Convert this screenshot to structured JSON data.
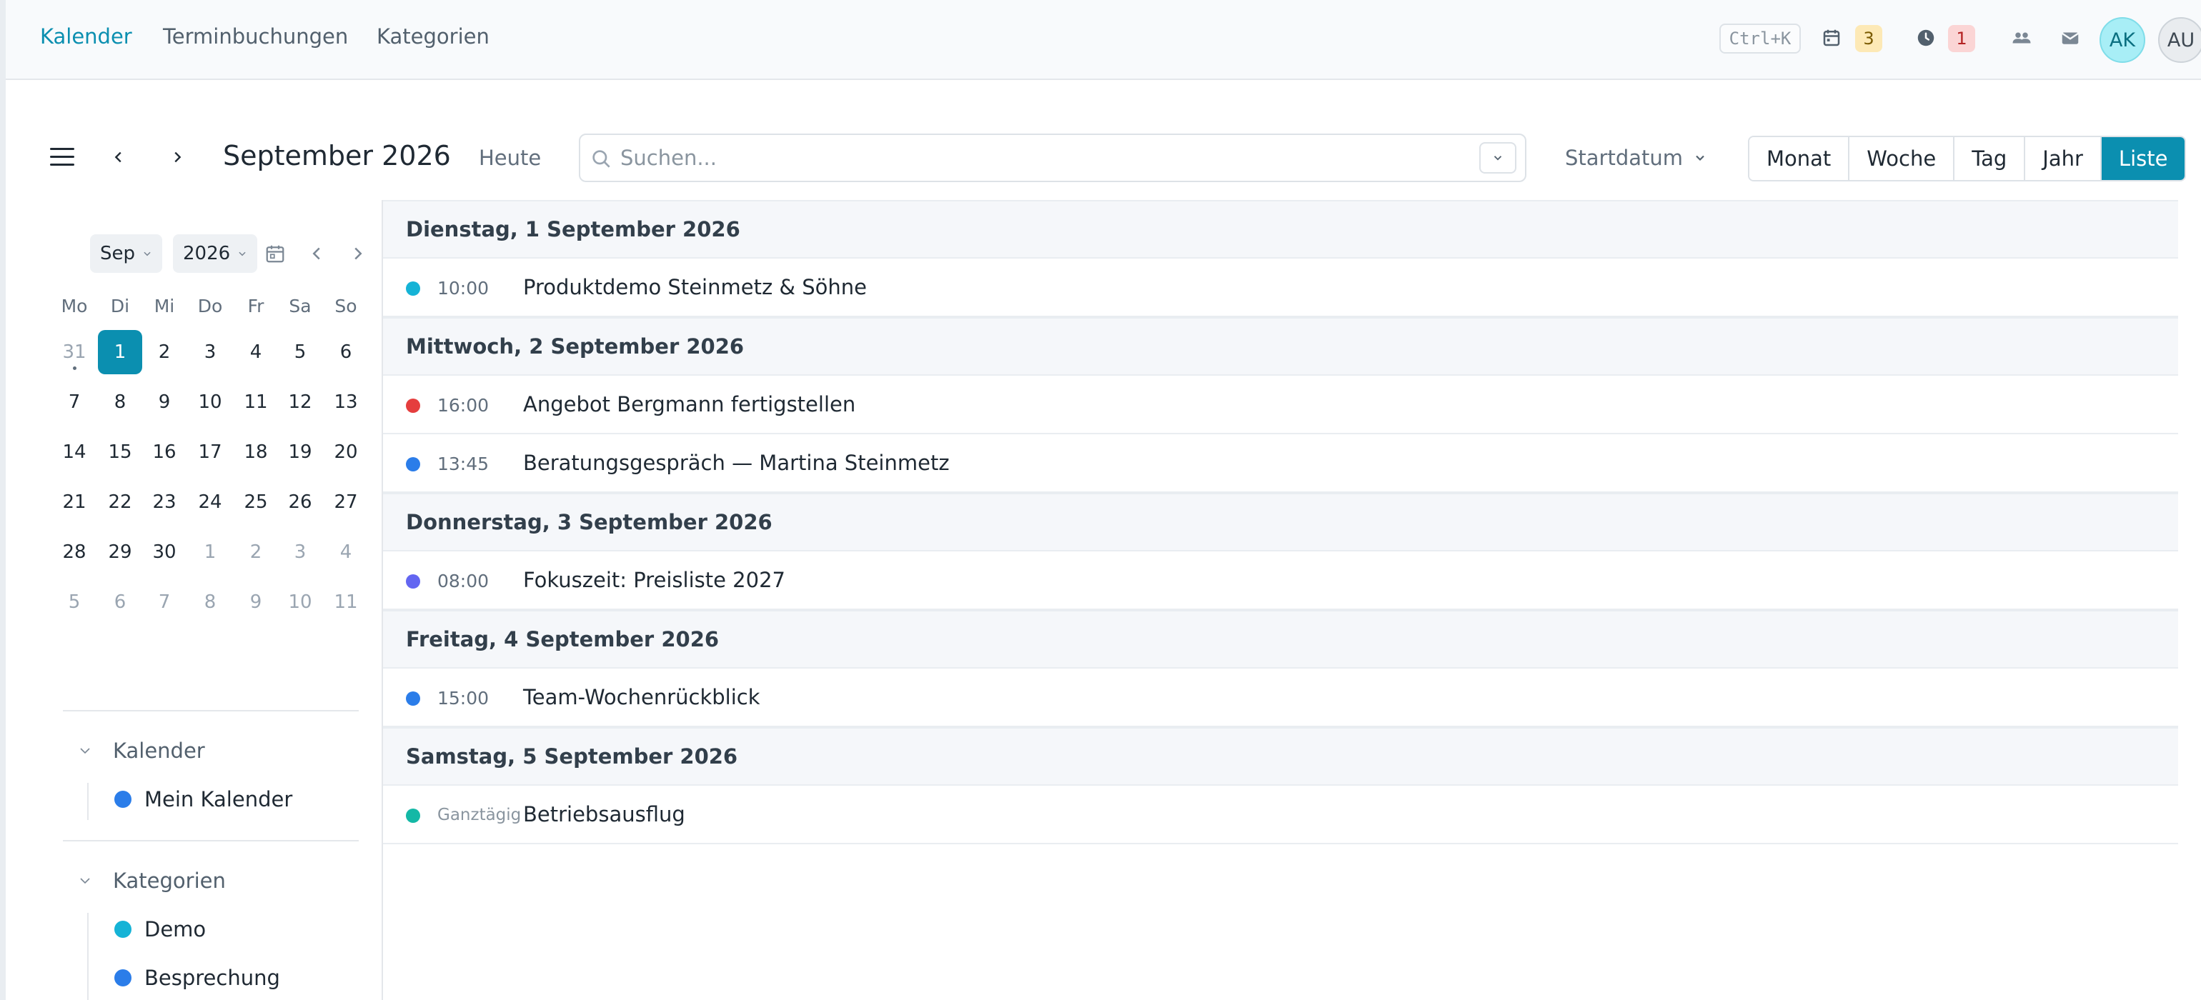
{
  "nav": {
    "links": [
      "Kalender",
      "Terminbuchungen",
      "Kategorien"
    ],
    "shortcut": "Ctrl+K",
    "calendar_badge": "3",
    "clock_badge": "1",
    "avatar_primary": "AK",
    "avatar_secondary": "AU",
    "accent_color": "#0b8fb0"
  },
  "toolbar": {
    "title": "September 2026",
    "today_label": "Heute",
    "search_placeholder": "Suchen...",
    "sort_label": "Startdatum",
    "views": [
      "Monat",
      "Woche",
      "Tag",
      "Jahr",
      "Liste"
    ],
    "active_view": "Liste"
  },
  "mini_calendar": {
    "month_select": "Sep",
    "year_select": "2026",
    "weekdays": [
      "Mo",
      "Di",
      "Mi",
      "Do",
      "Fr",
      "Sa",
      "So"
    ],
    "weeks": [
      [
        "31",
        "1",
        "2",
        "3",
        "4",
        "5",
        "6"
      ],
      [
        "7",
        "8",
        "9",
        "10",
        "11",
        "12",
        "13"
      ],
      [
        "14",
        "15",
        "16",
        "17",
        "18",
        "19",
        "20"
      ],
      [
        "21",
        "22",
        "23",
        "24",
        "25",
        "26",
        "27"
      ],
      [
        "28",
        "29",
        "30",
        "1",
        "2",
        "3",
        "4"
      ],
      [
        "5",
        "6",
        "7",
        "8",
        "9",
        "10",
        "11"
      ]
    ],
    "selected_day": "1"
  },
  "sidebar": {
    "calendars_heading": "Kalender",
    "calendars": [
      {
        "label": "Mein Kalender",
        "color": "#2b7de9"
      }
    ],
    "categories_heading": "Kategorien",
    "categories": [
      {
        "label": "Demo",
        "color": "#15b3d6"
      },
      {
        "label": "Besprechung",
        "color": "#2b7de9"
      }
    ]
  },
  "list": {
    "groups": [
      {
        "date": "Dienstag, 1 September 2026",
        "events": [
          {
            "time": "10:00",
            "title": "Produktdemo Steinmetz & Söhne",
            "color": "#15b3d6"
          }
        ]
      },
      {
        "date": "Mittwoch, 2 September 2026",
        "events": [
          {
            "time": "16:00",
            "title": "Angebot Bergmann fertigstellen",
            "color": "#e53e3e"
          },
          {
            "time": "13:45",
            "title": "Beratungsgespräch — Martina Steinmetz",
            "color": "#2b7de9"
          }
        ]
      },
      {
        "date": "Donnerstag, 3 September 2026",
        "events": [
          {
            "time": "08:00",
            "title": "Fokuszeit: Preisliste 2027",
            "color": "#6366f1"
          }
        ]
      },
      {
        "date": "Freitag, 4 September 2026",
        "events": [
          {
            "time": "15:00",
            "title": "Team-Wochenrückblick",
            "color": "#2b7de9"
          }
        ]
      },
      {
        "date": "Samstag, 5 September 2026",
        "events": [
          {
            "time": "Ganztägig",
            "title": "Betriebsausflug",
            "color": "#14b8a6",
            "allday": true
          }
        ]
      }
    ]
  }
}
